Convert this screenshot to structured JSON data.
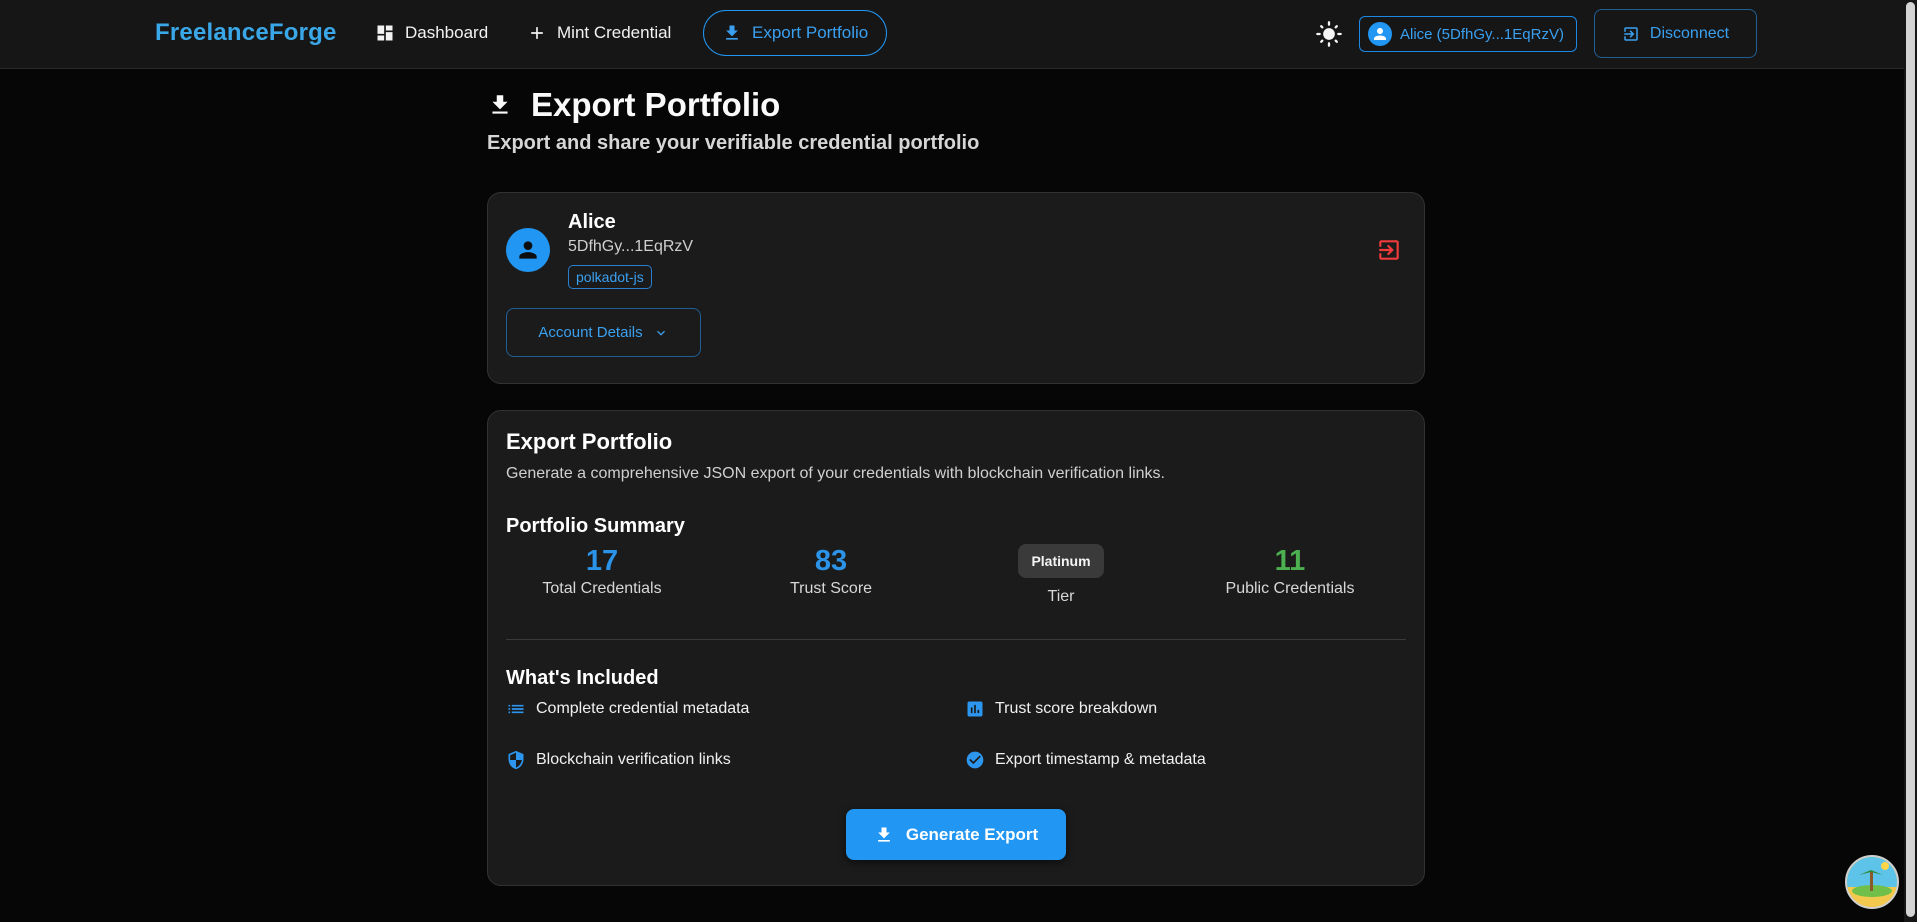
{
  "nav": {
    "brand": "FreelanceForge",
    "items": [
      {
        "label": "Dashboard",
        "icon": "dashboard-icon"
      },
      {
        "label": "Mint Credential",
        "icon": "plus-icon"
      },
      {
        "label": "Export Portfolio",
        "icon": "download-icon",
        "active": true
      }
    ],
    "account_chip": "Alice (5DfhGy...1EqRzV)",
    "disconnect_label": "Disconnect",
    "theme_icon": "sun-icon"
  },
  "header": {
    "title": "Export Portfolio",
    "subtitle": "Export and share your verifiable credential portfolio"
  },
  "account": {
    "name": "Alice",
    "address": "5DfhGy...1EqRzV",
    "wallet_tag": "polkadot-js",
    "details_label": "Account Details"
  },
  "export": {
    "title": "Export Portfolio",
    "description": "Generate a comprehensive JSON export of your credentials with blockchain verification links.",
    "summary_title": "Portfolio Summary",
    "stats": {
      "total_credentials": {
        "value": "17",
        "label": "Total Credentials"
      },
      "trust_score": {
        "value": "83",
        "label": "Trust Score"
      },
      "tier": {
        "value": "Platinum",
        "label": "Tier"
      },
      "public_credentials": {
        "value": "11",
        "label": "Public Credentials"
      }
    },
    "included_title": "What's Included",
    "features": [
      {
        "label": "Complete credential metadata",
        "icon": "list-icon"
      },
      {
        "label": "Trust score breakdown",
        "icon": "bar-chart-icon"
      },
      {
        "label": "Blockchain verification links",
        "icon": "shield-icon"
      },
      {
        "label": "Export timestamp & metadata",
        "icon": "check-circle-icon"
      }
    ],
    "generate_label": "Generate Export"
  },
  "colors": {
    "accent": "#2196f3",
    "brand": "#3aa8e8",
    "success": "#4caf50",
    "danger": "#ef3b3b",
    "background": "#060606",
    "card": "#1b1b1b"
  }
}
